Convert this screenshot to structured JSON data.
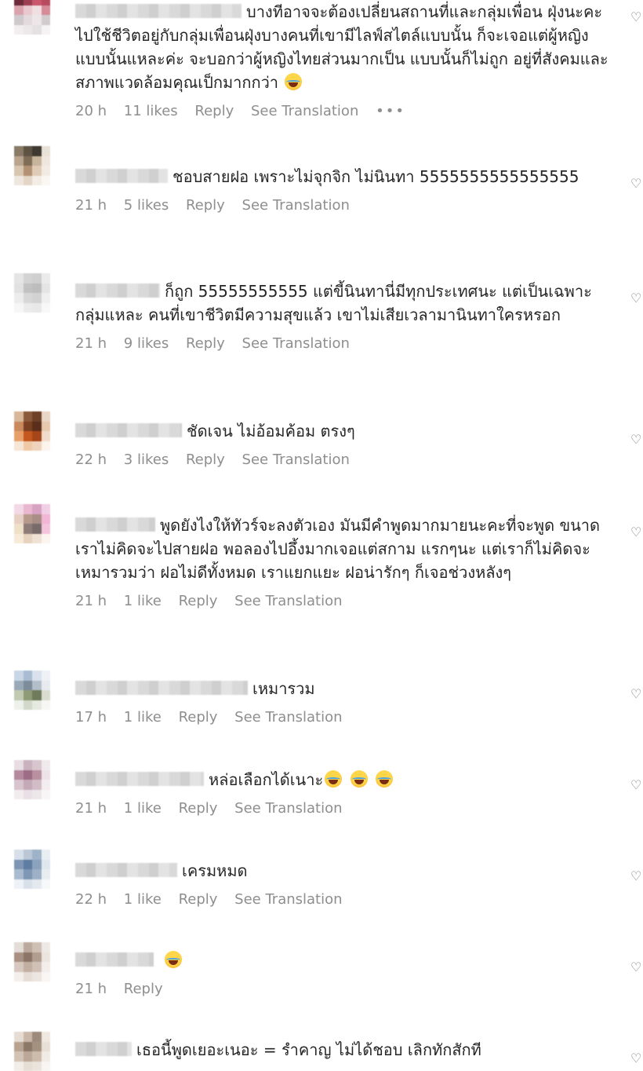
{
  "comments": [
    {
      "text": "บางทีอาจจะต้องเปลี่ยนสถานที่และกลุ่มเพื่อน ฝุ่งนะคะ ไปใช้ชีวิตอยู่กับกลุ่มเพื่อนฝุ่งบางคนที่เขามีไลฟ์สไตล์แบบนั้น ก็จะเจอแต่ผู้หญิงแบบนั้นแหละค่ะ จะบอกว่าผู้หญิงไทยส่วนมากเป็น แบบนั้นก็ไม่ถูก อยู่ที่สังคมและสภาพแวดล้อมคุณเป็กมากกว่า",
      "emoji": "face-with-tears-of-joy-icon",
      "time": "20 h",
      "likes": "11 likes",
      "reply": "Reply",
      "translation": "See Translation",
      "more": "•••",
      "avatar": [
        "#6e2a3a",
        "#9c3d52",
        "#c9566b",
        "#b84a5f",
        "#d9a3ad",
        "#e9c9cf",
        "#f0dfe2",
        "#d58b98",
        "#cfc9cb",
        "#e2dadd",
        "#ece6e8",
        "#d2cbce",
        "#f2eeef",
        "#ece8e9",
        "#e5e0e2",
        "#f5f3f4"
      ]
    },
    {
      "text": "ชอบสายฝอ เพราะไม่จุกจิก ไม่นินทา 5555555555555555",
      "time": "21 h",
      "likes": "5 likes",
      "reply": "Reply",
      "translation": "See Translation",
      "avatar": [
        "#8a7a68",
        "#5f5444",
        "#3e3a33",
        "#e8e1d8",
        "#b9a58e",
        "#806d57",
        "#c8b49c",
        "#efe7de",
        "#d8c6b1",
        "#b39273",
        "#e0ccb6",
        "#f1ebe4",
        "#efe7df",
        "#e4d6c6",
        "#f3ede6",
        "#faf7f3"
      ]
    },
    {
      "text": "ก็ถูก 55555555555 แต่ขี้นินทานี่มีทุกประเทศนะ แต่เป็นเฉพาะกลุ่มแหละ คนที่เขาชีวิตมีความสุขแล้ว เขาไม่เสียเวลามานินทาใครหรอก",
      "time": "21 h",
      "likes": "9 likes",
      "reply": "Reply",
      "translation": "See Translation",
      "avatar": [
        "#e5e5e5",
        "#d3d3d3",
        "#cfcfcf",
        "#ebebeb",
        "#e1e1e1",
        "#c2c2c2",
        "#bdbdbd",
        "#e4e4e4",
        "#ececec",
        "#d7d7d7",
        "#d2d2d2",
        "#efefef",
        "#f6f6f6",
        "#ebebeb",
        "#e8e8e8",
        "#f8f8f8"
      ]
    },
    {
      "text": "ชัดเจน ไม่อ้อมค้อม ตรงๆ",
      "time": "22 h",
      "likes": "3 likes",
      "reply": "Reply",
      "translation": "See Translation",
      "avatar": [
        "#d8b898",
        "#8b5a3c",
        "#6e4028",
        "#e9d6c4",
        "#c98a5e",
        "#7b3f22",
        "#5a2e1a",
        "#e6c8ad",
        "#e8a06a",
        "#c4581f",
        "#a4451a",
        "#f1dccb",
        "#f5e6d8",
        "#f0c9a6",
        "#efd4bd",
        "#fbf3ec"
      ]
    },
    {
      "text": "พูดยังไงให้ทัวร์จะลงตัวเอง มันมีคำพูดมากมายนะคะที่จะพูด ขนาดเราไม่คิดจะไปสายฝอ พอลองไปอึ้งมากเจอแต่สกาม แรกๆนะ แต่เราก็ไม่คิดจะเหมารวมว่า ฝอไม่ดีทั้งหมด เราแยกแยะ ฝอน่ารักๆ ก็เจอช่วงหลังๆ",
      "time": "21 h",
      "likes": "1 like",
      "reply": "Reply",
      "translation": "See Translation",
      "avatar": [
        "#f3d8e6",
        "#e9b7cf",
        "#d8a3c2",
        "#f1cfe4",
        "#e8cfc4",
        "#b79a8c",
        "#a88e86",
        "#f0b6d4",
        "#efe0c8",
        "#8d7c78",
        "#7a6b6b",
        "#f4c3dc",
        "#f7ead7",
        "#e6d3bd",
        "#efe2d4",
        "#fbf4ef"
      ]
    },
    {
      "text": "เหมารวม",
      "time": "17 h",
      "likes": "1 like",
      "reply": "Reply",
      "translation": "See Translation",
      "avatar": [
        "#c9d6e6",
        "#a9bcd4",
        "#d9e2ec",
        "#eef2f6",
        "#9aa9b8",
        "#7c8c9a",
        "#b3bec8",
        "#e7ebef",
        "#c2cbb2",
        "#8f9a76",
        "#6f7b5d",
        "#d9ddd0",
        "#eef0ea",
        "#d3d9c9",
        "#e6e9e0",
        "#f6f7f4"
      ]
    },
    {
      "text": "หล่อเลือกได้เนาะ",
      "emojis": [
        "face-with-tears-of-joy-icon",
        "face-with-tears-of-joy-icon",
        "face-with-tears-of-joy-icon"
      ],
      "time": "21 h",
      "likes": "1 like",
      "reply": "Reply",
      "translation": "See Translation",
      "avatar": [
        "#e7dde2",
        "#c9b2bd",
        "#d8c6cf",
        "#f0eaed",
        "#b58a9f",
        "#9c6d84",
        "#b8909f",
        "#ece2e7",
        "#d7c4cd",
        "#c4a9b6",
        "#d2bdc7",
        "#f3edf0",
        "#f2ecef",
        "#e9e0e5",
        "#eee7ea",
        "#f8f5f6"
      ]
    },
    {
      "text": "เครมหมด",
      "time": "22 h",
      "likes": "1 like",
      "reply": "Reply",
      "translation": "See Translation",
      "avatar": [
        "#d7e0ea",
        "#b9c7d6",
        "#9fb3c8",
        "#e9eef3",
        "#7e96b3",
        "#5f7da0",
        "#8aa2bd",
        "#dfe6ee",
        "#a9bbcf",
        "#7d97b4",
        "#9db0c6",
        "#e8edf2",
        "#eef2f6",
        "#d8e0e9",
        "#e3e9ef",
        "#f6f8fa"
      ]
    },
    {
      "text": "",
      "emojis": [
        "face-with-tears-of-joy-icon"
      ],
      "time": "21 h",
      "reply": "Reply",
      "avatar": [
        "#e3dcd7",
        "#bba99d",
        "#cfc0b6",
        "#efe9e5",
        "#a89182",
        "#8c7566",
        "#b29e90",
        "#ebe4df",
        "#d6c8bf",
        "#c2afa2",
        "#d0c1b7",
        "#f3eee9",
        "#f4efeb",
        "#e6ddd7",
        "#ece5e0",
        "#f8f5f3"
      ]
    },
    {
      "text": "เธอนี้พูดเยอะเนอะ = รำคาญ ไม่ได้ชอบ เลิกทักสักที",
      "avatar": [
        "#e6dcd3",
        "#c9b8a8",
        "#9c8b7d",
        "#efe8e1",
        "#b8a391",
        "#8c7867",
        "#a49281",
        "#e8dfd6",
        "#d2c3b4",
        "#bba897",
        "#cdbcab",
        "#f1ebe5",
        "#f2ede7",
        "#e6ddd4",
        "#ebe4dc",
        "#f8f5f2"
      ]
    }
  ]
}
